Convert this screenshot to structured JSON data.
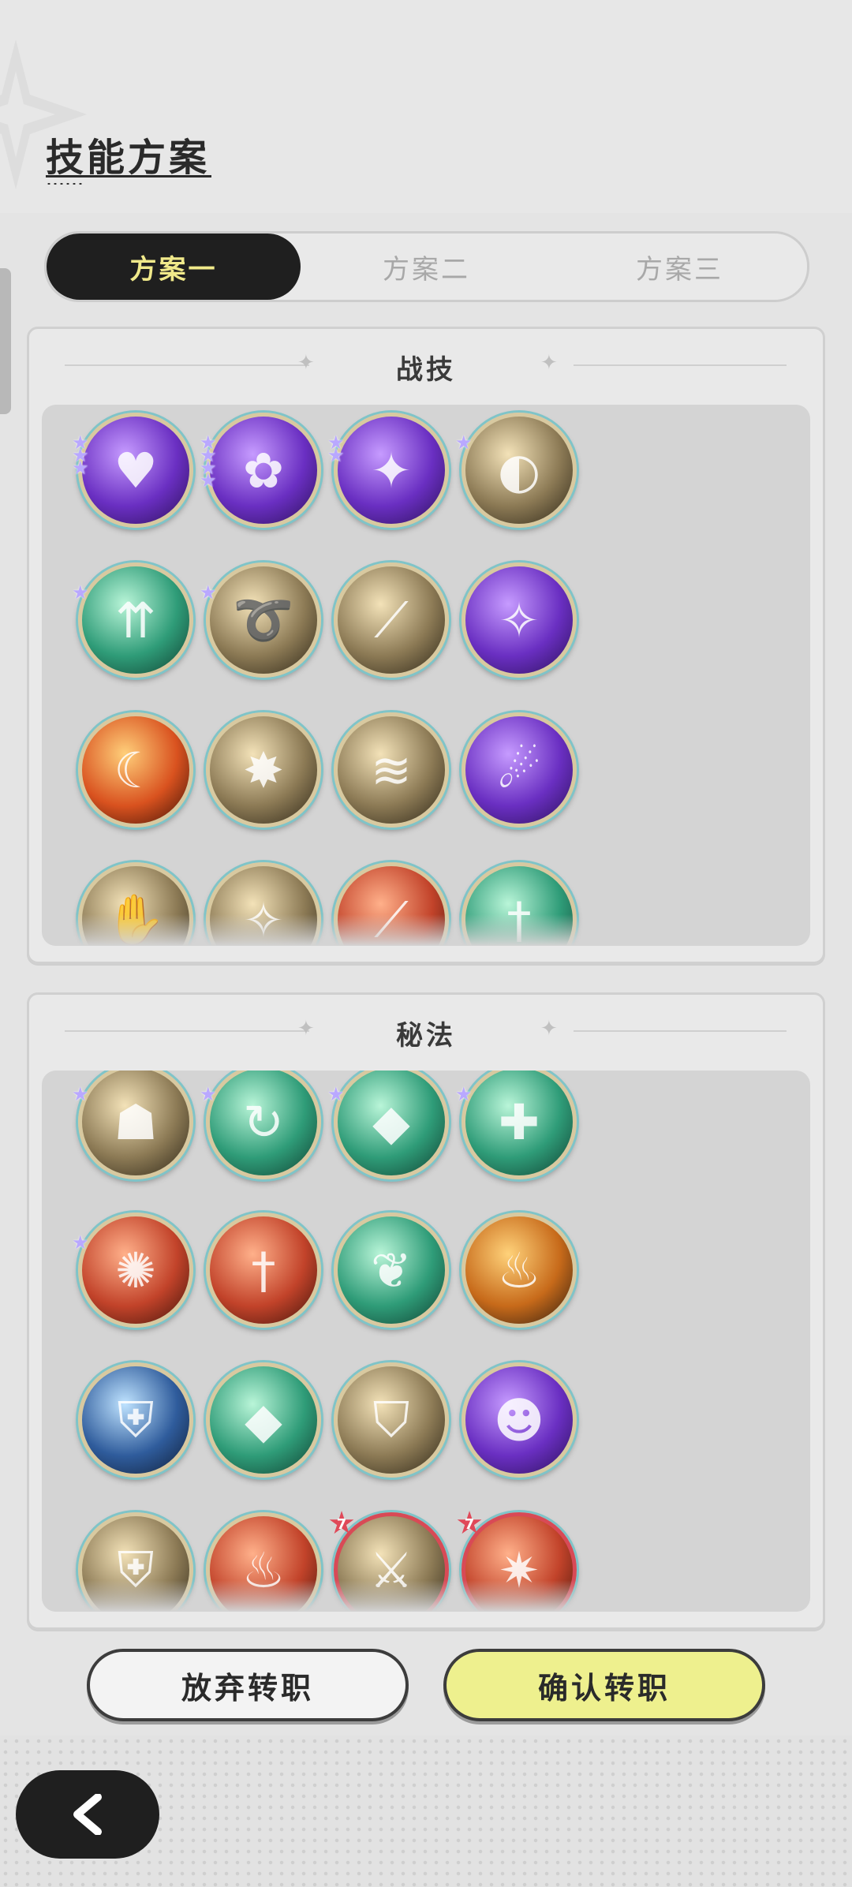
{
  "page": {
    "title": "技能方案"
  },
  "tabs": [
    {
      "label": "方案一",
      "active": true
    },
    {
      "label": "方案二",
      "active": false
    },
    {
      "label": "方案三",
      "active": false
    }
  ],
  "combat": {
    "title": "战技",
    "skills": [
      {
        "icon": "purple-heart-burst-icon",
        "stars": 3
      },
      {
        "icon": "purple-rose-thorns-icon",
        "stars": 4
      },
      {
        "icon": "purple-starburst-icon",
        "stars": 2
      },
      {
        "icon": "gold-whirlwind-icon",
        "stars": 1
      },
      {
        "icon": "green-arrows-up-icon",
        "stars": 1
      },
      {
        "icon": "gold-swirl-blades-icon",
        "stars": 1
      },
      {
        "icon": "gold-slash-icon",
        "stars": 0
      },
      {
        "icon": "purple-star-pattern-icon",
        "stars": 0
      },
      {
        "icon": "fire-crescent-icon",
        "stars": 0
      },
      {
        "icon": "gold-impact-spikes-icon",
        "stars": 0
      },
      {
        "icon": "gold-shadow-dash-icon",
        "stars": 0
      },
      {
        "icon": "purple-claw-icon",
        "stars": 0
      },
      {
        "icon": "gold-hand-strike-icon",
        "stars": 0
      },
      {
        "icon": "gold-star-flash-icon",
        "stars": 0
      },
      {
        "icon": "red-flame-slash-icon",
        "stars": 0
      },
      {
        "icon": "green-sword-icon",
        "stars": 0
      }
    ]
  },
  "secret": {
    "title": "秘法",
    "skills": [
      {
        "icon": "gold-guardian-icon",
        "stars": 1,
        "badge": ""
      },
      {
        "icon": "green-wind-arrow-icon",
        "stars": 1,
        "badge": ""
      },
      {
        "icon": "green-crystal-icon",
        "stars": 1,
        "badge": ""
      },
      {
        "icon": "green-heal-plus-icon",
        "stars": 1,
        "badge": ""
      },
      {
        "icon": "red-power-burst-icon",
        "stars": 1,
        "badge": ""
      },
      {
        "icon": "red-sword-plus-icon",
        "stars": 0,
        "badge": ""
      },
      {
        "icon": "green-leaf-icon",
        "stars": 0,
        "badge": ""
      },
      {
        "icon": "orange-flame-figure-icon",
        "stars": 0,
        "badge": ""
      },
      {
        "icon": "blue-shield-sigil-icon",
        "stars": 0,
        "badge": ""
      },
      {
        "icon": "green-crystal-up-icon",
        "stars": 0,
        "badge": ""
      },
      {
        "icon": "gold-armor-icon",
        "stars": 0,
        "badge": ""
      },
      {
        "icon": "purple-figure-aura-icon",
        "stars": 0,
        "badge": ""
      },
      {
        "icon": "gold-shield-plus-icon",
        "stars": 0,
        "badge": ""
      },
      {
        "icon": "red-flame-icon",
        "stars": 0,
        "badge": ""
      },
      {
        "icon": "gold-dagger-icon",
        "stars": 0,
        "badge": "7"
      },
      {
        "icon": "red-shatter-icon",
        "stars": 0,
        "badge": "7"
      }
    ]
  },
  "buttons": {
    "abandon": "放弃转职",
    "confirm": "确认转职"
  },
  "colors": {
    "active_tab_bg": "#1f1f1f",
    "active_tab_text": "#f0e98a",
    "confirm_bg": "#eef08e",
    "star": "#b9a8ff",
    "red_badge": "#e04858"
  }
}
